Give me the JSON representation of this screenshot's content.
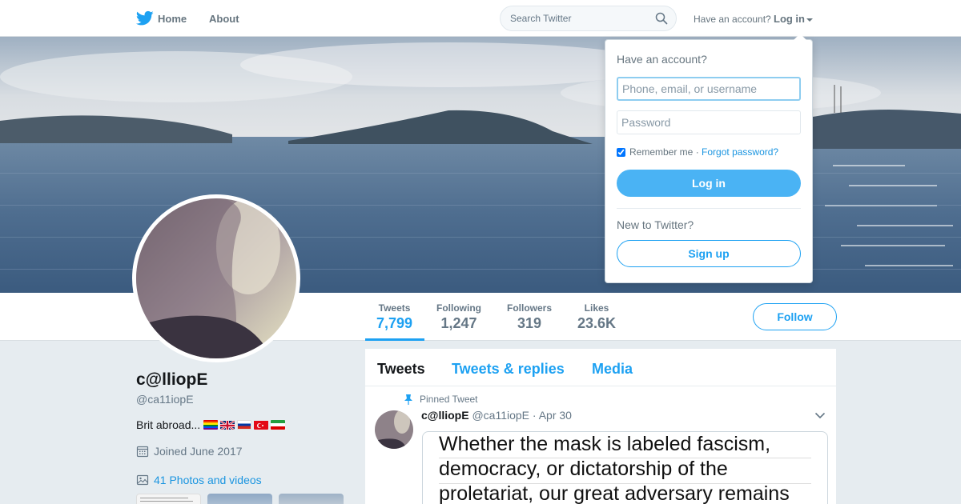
{
  "nav": {
    "home_label": "Home",
    "about_label": "About",
    "search_placeholder": "Search Twitter",
    "have_account": "Have an account?",
    "login_label": "Log in"
  },
  "profile": {
    "display_name": "c@lliopE",
    "screen_name": "@ca11iopE",
    "bio": "Brit abroad...",
    "bio_flags": [
      "rainbow-flag",
      "uk-flag",
      "russia-flag",
      "turkey-flag",
      "iran-flag"
    ],
    "joined": "Joined June 2017",
    "photos_link": "41 Photos and videos"
  },
  "stats": [
    {
      "label": "Tweets",
      "value": "7,799",
      "active": true
    },
    {
      "label": "Following",
      "value": "1,247",
      "active": false
    },
    {
      "label": "Followers",
      "value": "319",
      "active": false
    },
    {
      "label": "Likes",
      "value": "23.6K",
      "active": false
    }
  ],
  "follow_button": "Follow",
  "timeline": {
    "tabs": [
      "Tweets",
      "Tweets & replies",
      "Media"
    ],
    "pinned_label": "Pinned Tweet",
    "tweet": {
      "name": "c@lliopE",
      "handle": "@ca11iopE",
      "separator": "·",
      "date": "Apr 30",
      "image_text": [
        "Whether the mask is labeled fascism,",
        "democracy, or dictatorship of the",
        "proletariat, our great adversary remains"
      ]
    }
  },
  "login_dropdown": {
    "title": "Have an account?",
    "username_placeholder": "Phone, email, or username",
    "password_placeholder": "Password",
    "remember_me": "Remember me",
    "separator": "·",
    "forgot_password": "Forgot password?",
    "login_button": "Log in",
    "new_to_twitter": "New to Twitter?",
    "signup_button": "Sign up"
  },
  "colors": {
    "brand_blue": "#1da1f2",
    "link_blue": "#1b95e0",
    "background": "#e6ecf0"
  }
}
